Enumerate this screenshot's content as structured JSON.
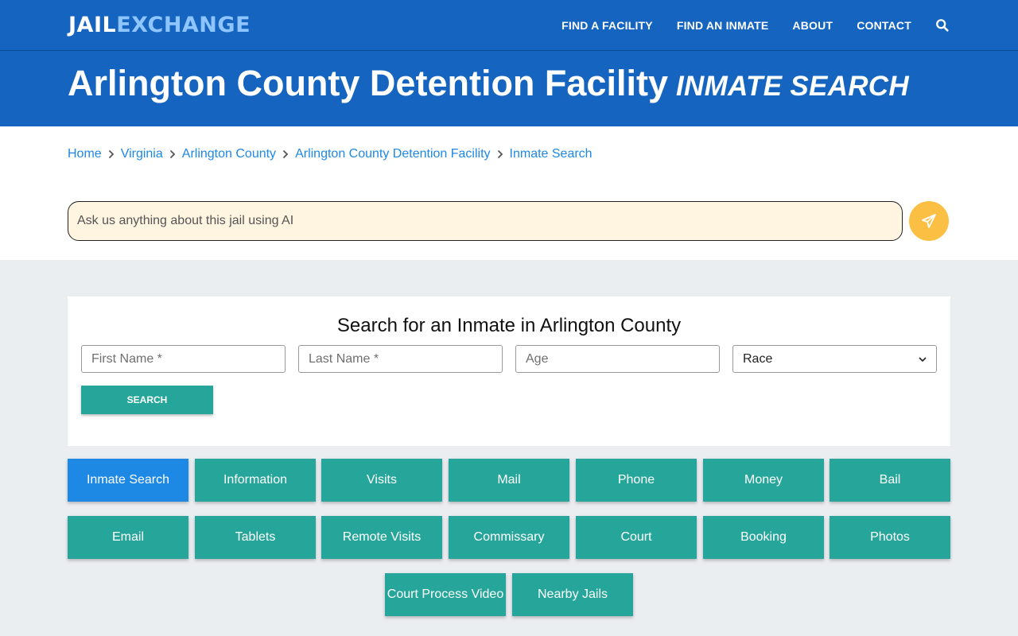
{
  "logo": {
    "part1": "JAIL",
    "part2": "EXCHANGE"
  },
  "nav": {
    "links": [
      "FIND A FACILITY",
      "FIND AN INMATE",
      "ABOUT",
      "CONTACT"
    ],
    "search_icon": "search-icon"
  },
  "title": {
    "main": "Arlington County Detention Facility",
    "sub": "INMATE SEARCH"
  },
  "breadcrumb": [
    "Home",
    "Virginia",
    "Arlington County",
    "Arlington County Detention Facility",
    "Inmate Search"
  ],
  "ai": {
    "placeholder": "Ask us anything about this jail using AI",
    "send_icon": "paper-plane-icon"
  },
  "search_card": {
    "title": "Search for an Inmate in Arlington County",
    "first_name_placeholder": "First Name *",
    "last_name_placeholder": "Last Name *",
    "age_placeholder": "Age",
    "race_selected": "Race",
    "button_label": "SEARCH"
  },
  "tiles": {
    "row1": [
      "Inmate Search",
      "Information",
      "Visits",
      "Mail",
      "Phone",
      "Money",
      "Bail"
    ],
    "row2": [
      "Email",
      "Tablets",
      "Remote Visits",
      "Commissary",
      "Court",
      "Booking",
      "Photos"
    ],
    "row3": [
      "Court Process Video",
      "Nearby Jails"
    ],
    "active": "Inmate Search"
  },
  "colors": {
    "header_blue": "#1565c0",
    "accent_teal": "#26a69a",
    "active_blue": "#1e88e5",
    "ai_send": "#fbbf44",
    "ai_box_bg": "#fff5e1"
  }
}
